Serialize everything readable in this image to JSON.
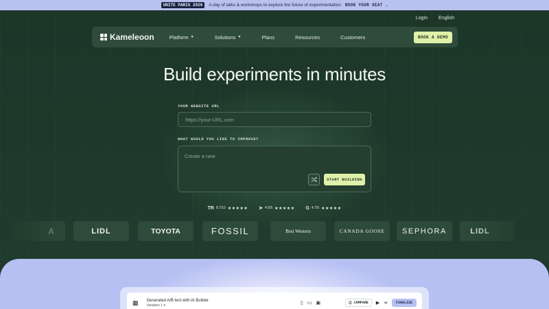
{
  "announcement": {
    "tag": "UNITE PARIS 2026",
    "text": "A day of talks & workshops to explore the future of experimentation",
    "cta": "BOOK YOUR SEAT"
  },
  "util_links": {
    "login": "Login",
    "language": "English"
  },
  "nav": {
    "brand": "Kameleoon",
    "items": [
      {
        "label": "Platform",
        "dropdown": true
      },
      {
        "label": "Solutions",
        "dropdown": true
      },
      {
        "label": "Plans",
        "dropdown": false
      },
      {
        "label": "Resources",
        "dropdown": false
      },
      {
        "label": "Customers",
        "dropdown": false
      }
    ],
    "demo_button": "BOOK A DEMO"
  },
  "hero": {
    "title": "Build experiments in minutes",
    "url_label": "YOUR WEBSITE URL",
    "url_placeholder": "https://your-URL.com",
    "improve_label": "WHAT WOULD YOU LIKE TO IMPROVE?",
    "improve_placeholder": "Create a new",
    "start_button": "START BUILDING"
  },
  "ratings": [
    {
      "source_icon": "trustradius-icon",
      "source_mark": "TR",
      "score": "8.7/10",
      "stars": "★★★★★"
    },
    {
      "source_icon": "capterra-icon",
      "source_mark": "➤",
      "score": "4.6/5",
      "stars": "★★★★★"
    },
    {
      "source_icon": "g2-icon",
      "source_mark": "G",
      "score": "4.7/5",
      "stars": "★★★★★"
    }
  ],
  "logos": [
    {
      "name": "A"
    },
    {
      "name": "LIDL"
    },
    {
      "name": "TOYOTA"
    },
    {
      "name": "FOSSIL"
    },
    {
      "name": "Best Western"
    },
    {
      "name": "CANADA GOOSE"
    },
    {
      "name": "SEPHORA"
    },
    {
      "name": "LIDL"
    }
  ],
  "app_preview": {
    "title": "Generated A/B test with AI Builder",
    "variation": "Variation 1",
    "compare": "COMPARE",
    "finalize": "FINALIZE"
  },
  "colors": {
    "banner_bg": "#b9c2ef",
    "hero_bg": "#1f3a2c",
    "accent_lime": "#dff1a8",
    "lower_bg": "#b7c0f3"
  }
}
